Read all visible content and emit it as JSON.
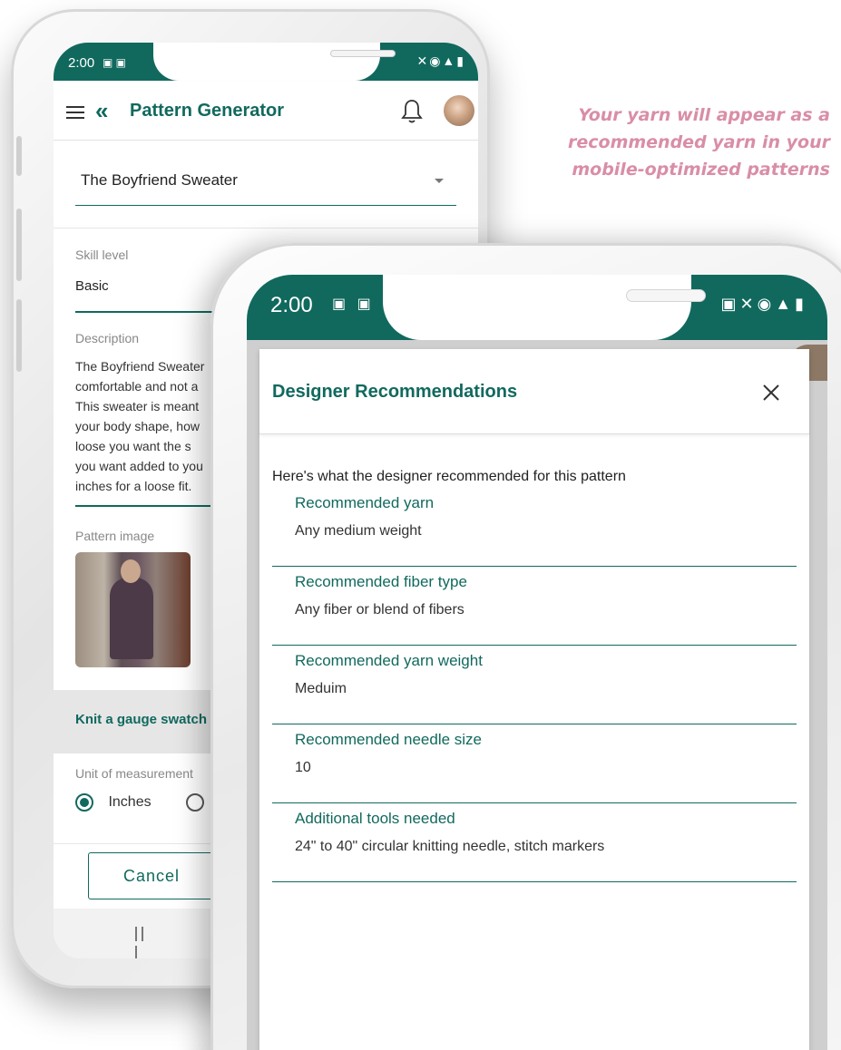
{
  "caption": {
    "line1": "Your yarn will appear as a",
    "line2": "recommended yarn in your",
    "line3": "mobile-optimized patterns"
  },
  "back_phone": {
    "status_time": "2:00",
    "app_title": "Pattern Generator",
    "pattern_select": "The Boyfriend Sweater",
    "skill_label": "Skill level",
    "skill_value": "Basic",
    "description_label": "Description",
    "description_lines": [
      "The Boyfriend Sweater",
      "comfortable and not a",
      "This sweater is meant",
      "your body shape, how",
      "loose you want the s",
      "you want added to you",
      "inches for a loose fit."
    ],
    "pattern_image_label": "Pattern image",
    "gauge_section": "Knit a gauge swatch",
    "unit_label": "Unit of measurement",
    "unit_option_selected": "Inches",
    "cancel_button": "Cancel",
    "nav_recents": "|||"
  },
  "front_phone": {
    "status_time": "2:00",
    "dialog_title": "Designer Recommendations",
    "close_icon": "close-icon",
    "intro_text": "Here's what the designer recommended for this pattern",
    "recommendations": [
      {
        "label": "Recommended yarn",
        "value": "Any medium weight"
      },
      {
        "label": "Recommended fiber type",
        "value": "Any fiber or blend of fibers"
      },
      {
        "label": "Recommended yarn weight",
        "value": "Meduim"
      },
      {
        "label": "Recommended needle size",
        "value": "10"
      },
      {
        "label": "Additional tools needed",
        "value": "24\" to 40\" circular knitting needle, stitch markers"
      }
    ]
  },
  "colors": {
    "brand_teal": "#11695e",
    "caption_pink": "#d98ea6"
  }
}
